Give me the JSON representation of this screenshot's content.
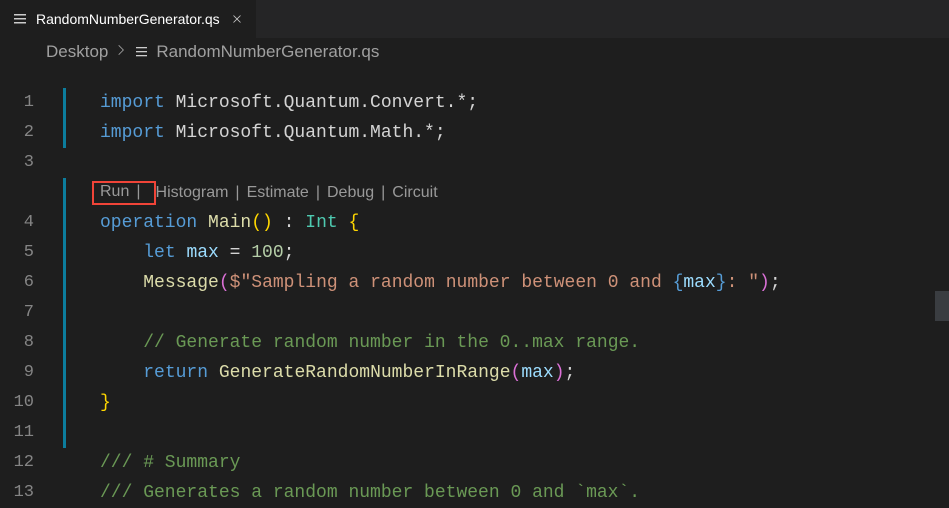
{
  "tab": {
    "filename": "RandomNumberGenerator.qs"
  },
  "breadcrumbs": {
    "items": [
      "Desktop",
      "RandomNumberGenerator.qs"
    ]
  },
  "lineNumbers": [
    "1",
    "2",
    "3",
    "4",
    "5",
    "6",
    "7",
    "8",
    "9",
    "10",
    "11",
    "12",
    "13"
  ],
  "codelens": {
    "run": "Run",
    "histogram": "Histogram",
    "estimate": "Estimate",
    "debug": "Debug",
    "circuit": "Circuit"
  },
  "code": {
    "l1": {
      "kw": "import",
      "ns": " Microsoft.Quantum.Convert.*",
      "semi": ";"
    },
    "l2": {
      "kw": "import",
      "ns": " Microsoft.Quantum.Math.*",
      "semi": ";"
    },
    "l4": {
      "kw": "operation ",
      "fn": "Main",
      "paren": "()",
      "colon": " : ",
      "typ": "Int",
      "brace": " {"
    },
    "l5": {
      "indent": "    ",
      "kw": "let ",
      "var": "max",
      "eq": " = ",
      "num": "100",
      "semi": ";"
    },
    "l6": {
      "indent": "    ",
      "fn": "Message",
      "open": "(",
      "dollar": "$",
      "quote1": "\"",
      "str1": "Sampling a random number between 0 and ",
      "iopen": "{",
      "ivar": "max",
      "iclose": "}",
      "str2": ": ",
      "quote2": "\"",
      "close": ")",
      "semi": ";"
    },
    "l8": {
      "indent": "    ",
      "cmt": "// Generate random number in the 0..max range."
    },
    "l9": {
      "indent": "    ",
      "kw": "return ",
      "fn": "GenerateRandomNumberInRange",
      "open": "(",
      "var": "max",
      "close": ")",
      "semi": ";"
    },
    "l10": {
      "brace": "}"
    },
    "l12": {
      "cmt": "/// # Summary"
    },
    "l13": {
      "cmt": "/// Generates a random number between 0 and `max`."
    }
  }
}
